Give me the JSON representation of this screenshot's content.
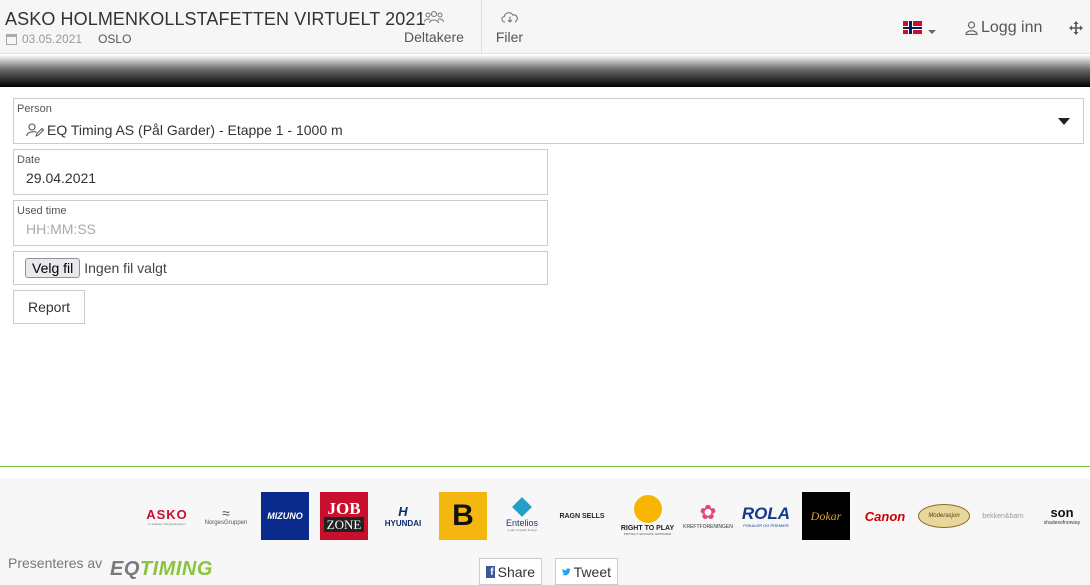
{
  "header": {
    "title": "ASKO HOLMENKOLLSTAFETTEN VIRTUELT 2021",
    "date": "03.05.2021",
    "location": "OSLO",
    "nav": [
      {
        "label": "Deltakere",
        "icon": "users-icon"
      },
      {
        "label": "Filer",
        "icon": "cloud-download-icon"
      }
    ],
    "language_flag": "norway-flag-icon",
    "login_label": "Logg inn"
  },
  "form": {
    "person": {
      "label": "Person",
      "value": "EQ Timing AS (Pål Garder) - Etappe 1 - 1000 m"
    },
    "date": {
      "label": "Date",
      "value": "29.04.2021"
    },
    "used_time": {
      "label": "Used time",
      "placeholder": "HH:MM:SS"
    },
    "file": {
      "button_label": "Velg fil",
      "status": "Ingen fil valgt"
    },
    "report_label": "Report"
  },
  "footer": {
    "sponsors": [
      {
        "name": "ASKO",
        "sub": "et selskap i NorgesGruppen"
      },
      {
        "name": "NorgesGruppen"
      },
      {
        "name": "MIZUNO"
      },
      {
        "name": "JOB",
        "sub": "ZONE"
      },
      {
        "name": "HYUNDAI"
      },
      {
        "name": "B"
      },
      {
        "name": "Entelios",
        "sub": "a part of Agder Energi"
      },
      {
        "name": "RAGN SELLS"
      },
      {
        "name": "RIGHT TO PLAY",
        "sub": "PROTECT. EDUCATE. EMPOWER"
      },
      {
        "name": "KREFTFORENINGEN"
      },
      {
        "name": "ROLA",
        "sub": "POKALER OG PREMIER"
      },
      {
        "name": "Dokar"
      },
      {
        "name": "Canon"
      },
      {
        "name": "Moderasjon"
      },
      {
        "name": "bekken&barn"
      },
      {
        "name": "son",
        "sub": "shadesofnorway"
      }
    ],
    "presented_by": "Presenteres av",
    "brand": {
      "prefix": "EQ",
      "suffix": "TIMING"
    },
    "share_label": "Share",
    "tweet_label": "Tweet"
  }
}
